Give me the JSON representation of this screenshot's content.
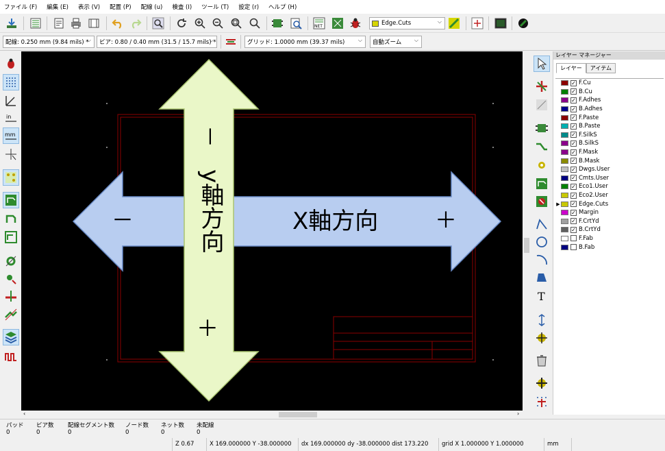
{
  "menu": [
    "ファイル (F)",
    "編集 (E)",
    "表示 (V)",
    "配置 (P)",
    "配線 (u)",
    "検査 (I)",
    "ツール (T)",
    "設定 (r)",
    "ヘルプ (H)"
  ],
  "toolbar": {
    "layer_select": "Edge.Cuts",
    "layer_select_color": "#d6d600"
  },
  "toolbar2": {
    "track_select": "配線: 0.250 mm (9.84 mils) *",
    "via_select": "ビア: 0.80 / 0.40 mm (31.5 / 15.7 mils) *",
    "grid_select": "グリッド: 1.0000 mm (39.37 mils)",
    "zoom_select": "自動ズーム"
  },
  "canvas": {
    "x_arrow_label": "X軸方向",
    "x_minus": "－",
    "x_plus": "＋",
    "y_arrow_label": "y軸方向",
    "y_minus": "－",
    "y_plus": "＋",
    "background": "#000000",
    "board_outline_color": "#8b0000",
    "arrow_fill": "#b8cdf0",
    "y_arrow_fill": "#eaf7c8"
  },
  "layer_manager": {
    "title": "レイヤー マネージャー",
    "tabs": [
      "レイヤー",
      "アイテム"
    ],
    "active_layer": "Edge.Cuts",
    "layers": [
      {
        "name": "F.Cu",
        "color": "#8b0000",
        "checked": true
      },
      {
        "name": "B.Cu",
        "color": "#008000",
        "checked": true
      },
      {
        "name": "F.Adhes",
        "color": "#8b008b",
        "checked": true
      },
      {
        "name": "B.Adhes",
        "color": "#00008b",
        "checked": true
      },
      {
        "name": "F.Paste",
        "color": "#8b0000",
        "checked": true
      },
      {
        "name": "B.Paste",
        "color": "#00b0b0",
        "checked": true
      },
      {
        "name": "F.SilkS",
        "color": "#008b8b",
        "checked": true
      },
      {
        "name": "B.SilkS",
        "color": "#8b008b",
        "checked": true
      },
      {
        "name": "F.Mask",
        "color": "#8b008b",
        "checked": true
      },
      {
        "name": "B.Mask",
        "color": "#8b8b00",
        "checked": true
      },
      {
        "name": "Dwgs.User",
        "color": "#c0c0c0",
        "checked": true
      },
      {
        "name": "Cmts.User",
        "color": "#000080",
        "checked": true
      },
      {
        "name": "Eco1.User",
        "color": "#008000",
        "checked": true
      },
      {
        "name": "Eco2.User",
        "color": "#c8c800",
        "checked": true
      },
      {
        "name": "Edge.Cuts",
        "color": "#c8c800",
        "checked": true
      },
      {
        "name": "Margin",
        "color": "#cc00cc",
        "checked": true
      },
      {
        "name": "F.CrtYd",
        "color": "#a0a0a0",
        "checked": true
      },
      {
        "name": "B.CrtYd",
        "color": "#606060",
        "checked": true
      },
      {
        "name": "F.Fab",
        "color": "#ffffff",
        "checked": false
      },
      {
        "name": "B.Fab",
        "color": "#000080",
        "checked": false
      }
    ]
  },
  "status": {
    "headers": [
      "パッド",
      "ビア数",
      "配線セグメント数",
      "ノード数",
      "ネット数",
      "未配線"
    ],
    "values": [
      "0",
      "0",
      "0",
      "0",
      "0",
      "0"
    ],
    "zoom": "Z 0.67",
    "coords": "X 169.000000  Y -38.000000",
    "delta": "dx 169.000000  dy -38.000000  dist 173.220",
    "grid": "grid X 1.000000  Y 1.000000",
    "units": "mm"
  }
}
